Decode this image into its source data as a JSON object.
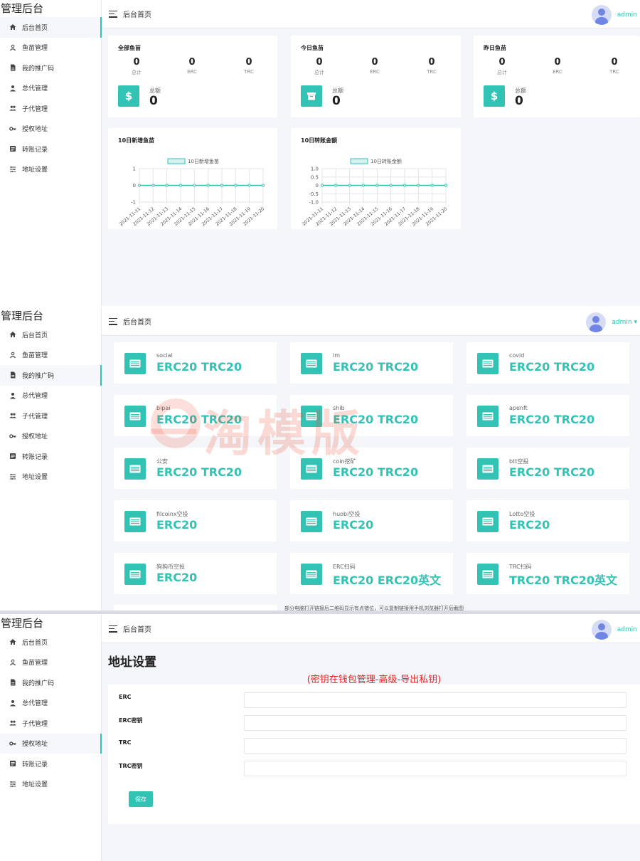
{
  "brand": "管理后台",
  "topbar_title": "后台首页",
  "user": {
    "name": "admin",
    "name_with_caret": "admin ▾"
  },
  "sidebar": {
    "items": [
      {
        "label": "后台首页",
        "icon": "home-icon"
      },
      {
        "label": "鱼苗管理",
        "icon": "fish-icon"
      },
      {
        "label": "我的推广码",
        "icon": "document-icon"
      },
      {
        "label": "总代管理",
        "icon": "person-icon"
      },
      {
        "label": "子代管理",
        "icon": "group-icon"
      },
      {
        "label": "授权地址",
        "icon": "key-icon"
      },
      {
        "label": "转账记录",
        "icon": "list-icon"
      },
      {
        "label": "地址设置",
        "icon": "settings-icon"
      }
    ]
  },
  "stats": [
    {
      "title": "全部鱼苗",
      "values": [
        "0",
        "0",
        "0"
      ],
      "labels": [
        "总计",
        "ERC",
        "TRC"
      ],
      "total_label": "总额",
      "total_value": "0",
      "icon": "dollar-icon"
    },
    {
      "title": "今日鱼苗",
      "values": [
        "0",
        "0",
        "0"
      ],
      "labels": [
        "总计",
        "ERC",
        "TRC"
      ],
      "total_label": "总额",
      "total_value": "0",
      "icon": "archive-icon"
    },
    {
      "title": "昨日鱼苗",
      "values": [
        "0",
        "0",
        "0"
      ],
      "labels": [
        "总计",
        "ERC",
        "TRC"
      ],
      "total_label": "总额",
      "total_value": "0",
      "icon": "dollar-icon"
    }
  ],
  "chart_data": [
    {
      "type": "line",
      "title": "10日新增鱼苗",
      "legend": "10日新增鱼苗",
      "legend_position": "top-center",
      "x": [
        "2021-11-11",
        "2021-11-12",
        "2021-11-13",
        "2021-11-14",
        "2021-11-15",
        "2021-11-16",
        "2021-11-17",
        "2021-11-18",
        "2021-11-19",
        "2021-11-20"
      ],
      "series": [
        {
          "name": "10日新增鱼苗",
          "values": [
            0,
            0,
            0,
            0,
            0,
            0,
            0,
            0,
            0,
            0
          ]
        }
      ],
      "yticks": [
        "1",
        "0",
        "-1"
      ],
      "yvalues": [
        1,
        0,
        -1
      ],
      "ylim": [
        -1,
        1
      ],
      "grid": true,
      "color": "#33c3b4"
    },
    {
      "type": "line",
      "title": "10日转账金额",
      "legend": "10日转账金额",
      "legend_position": "top-center",
      "x": [
        "2021-11-11",
        "2021-11-12",
        "2021-11-13",
        "2021-11-14",
        "2021-11-15",
        "2021-11-16",
        "2021-11-17",
        "2021-11-18",
        "2021-11-19",
        "2021-11-20"
      ],
      "series": [
        {
          "name": "10日转账金额",
          "values": [
            0,
            0,
            0,
            0,
            0,
            0,
            0,
            0,
            0,
            0
          ]
        }
      ],
      "yticks": [
        "1.0",
        "0.5",
        "0",
        "-0.5",
        "-1.0"
      ],
      "yvalues": [
        1,
        0.5,
        0,
        -0.5,
        -1
      ],
      "ylim": [
        -1,
        1
      ],
      "grid": true,
      "color": "#33c3b4"
    }
  ],
  "cards": [
    {
      "label": "social",
      "value": "ERC20 TRC20"
    },
    {
      "label": "im",
      "value": "ERC20 TRC20"
    },
    {
      "label": "covid",
      "value": "ERC20 TRC20"
    },
    {
      "label": "bipai",
      "value": "ERC20 TRC20"
    },
    {
      "label": "shib",
      "value": "ERC20 TRC20"
    },
    {
      "label": "apenft",
      "value": "ERC20 TRC20"
    },
    {
      "label": "公安",
      "value": "ERC20 TRC20"
    },
    {
      "label": "coin挖矿",
      "value": "ERC20 TRC20"
    },
    {
      "label": "btt空投",
      "value": "ERC20 TRC20"
    },
    {
      "label": "filcoinx空投",
      "value": "ERC20"
    },
    {
      "label": "huobi空投",
      "value": "ERC20"
    },
    {
      "label": "Lotto空投",
      "value": "ERC20"
    },
    {
      "label": "狗狗币空投",
      "value": "ERC20"
    },
    {
      "label": "ERC扫码",
      "value": "ERC20 ERC20英文"
    },
    {
      "label": "TRC扫码",
      "value": "TRC20 TRC20英文"
    }
  ],
  "watermark": "一淘模版",
  "bottom_note": "部分电脑打开链接后二维码显示有点错位，可以复制链接用手机浏览器打开后截图",
  "address_settings": {
    "heading": "地址设置",
    "note": "(密钥在钱包管理-高级-导出私钥)",
    "fields": [
      {
        "label": "ERC",
        "value": ""
      },
      {
        "label": "ERC密钥",
        "value": ""
      },
      {
        "label": "TRC",
        "value": ""
      },
      {
        "label": "TRC密钥",
        "value": ""
      }
    ],
    "save_label": "保存"
  },
  "colors": {
    "accent": "#33c3b4",
    "note_red": "#e02424",
    "avatar": "#6f86e5"
  }
}
